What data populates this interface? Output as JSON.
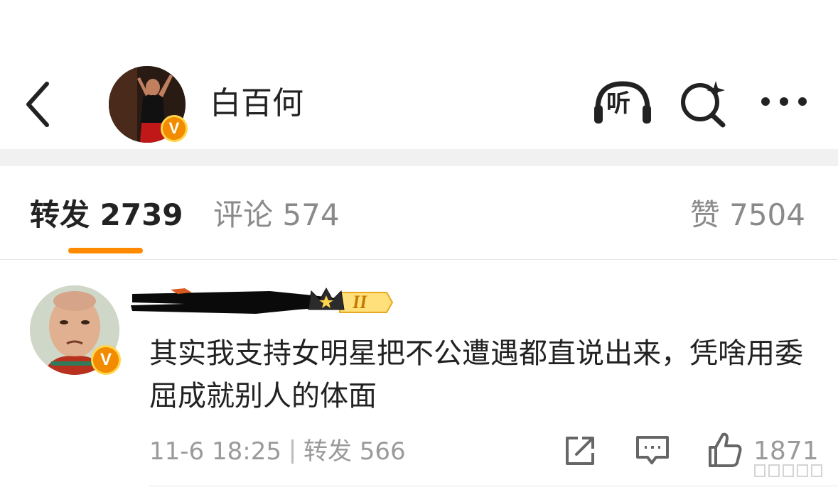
{
  "header": {
    "author_name": "白百何",
    "listen_label": "听",
    "verified_mark": "V"
  },
  "tabs": [
    {
      "label": "转发",
      "count": "2739"
    },
    {
      "label": "评论",
      "count": "574"
    },
    {
      "label": "赞",
      "count": "7504"
    }
  ],
  "repost": {
    "vip_level": "II",
    "verified_mark": "V",
    "text": "其实我支持女明星把不公遭遇都直说出来，凭啥用委屈成就别人的体面",
    "time": "11-6 18:25",
    "repost_label": "转发",
    "repost_count": "566",
    "like_count": "1871"
  },
  "colors": {
    "accent": "#ff8a00",
    "verified": "#f28b00",
    "muted": "#9a9a9a"
  },
  "icons": [
    "back-arrow-icon",
    "listen-headphone-icon",
    "search-sparkle-icon",
    "more-icon",
    "share-icon",
    "comment-icon",
    "like-thumb-icon",
    "crown-icon"
  ]
}
